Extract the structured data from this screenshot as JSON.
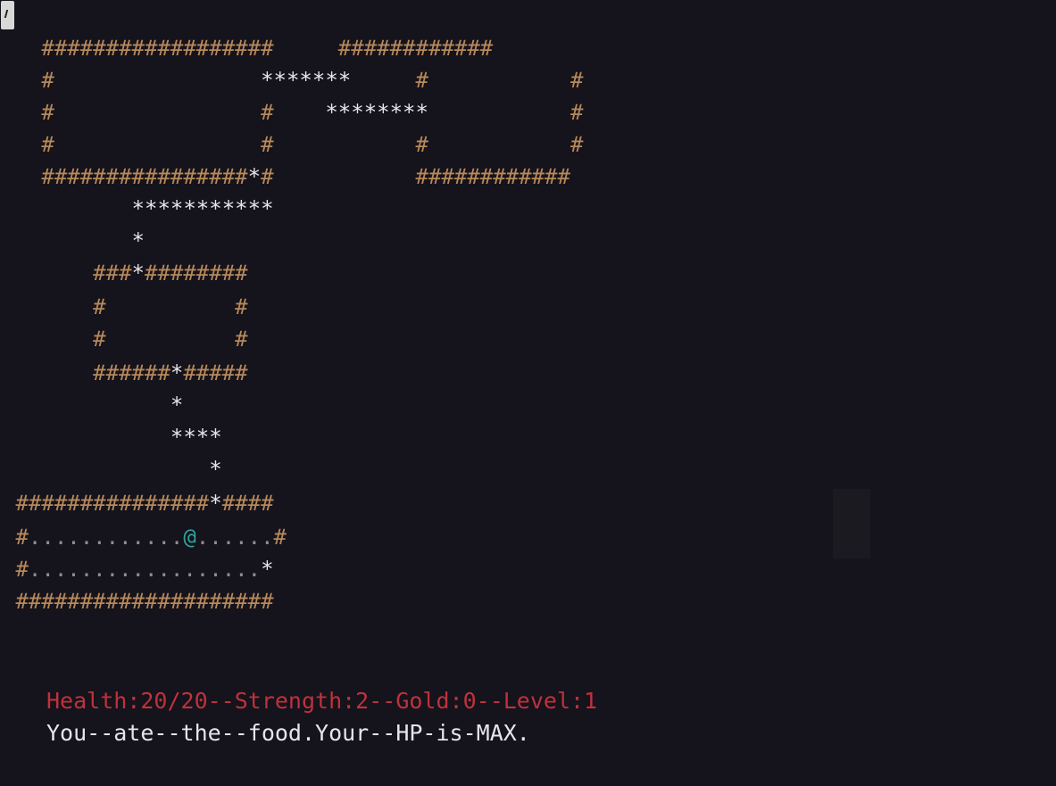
{
  "status": {
    "text": "Health:20/20--Strength:2--Gold:0--Level:1"
  },
  "message": {
    "text": "You--ate--the--food.Your--HP-is-MAX."
  },
  "map": {
    "rows": [
      "   ##################     ############",
      "   #                *******     #           #",
      "   #                #    ********           #",
      "   #                #           #           #",
      "   ################*#           ############",
      "          ***********",
      "          *",
      "       ###*########",
      "       #          #",
      "       #          #",
      "       ######*#####",
      "             *",
      "             ****",
      "                *",
      " ###############*####",
      " #............@......#",
      " #..................*",
      " ####################"
    ]
  },
  "colors": {
    "background": "#15131b",
    "wall": "#b8895a",
    "corridor": "#e7e5ea",
    "floor": "#8e8c96",
    "player": "#2fa39a",
    "status": "#c0313c",
    "message": "#e7e5ea"
  },
  "icons": {
    "corner": "terminal-tab-icon"
  }
}
